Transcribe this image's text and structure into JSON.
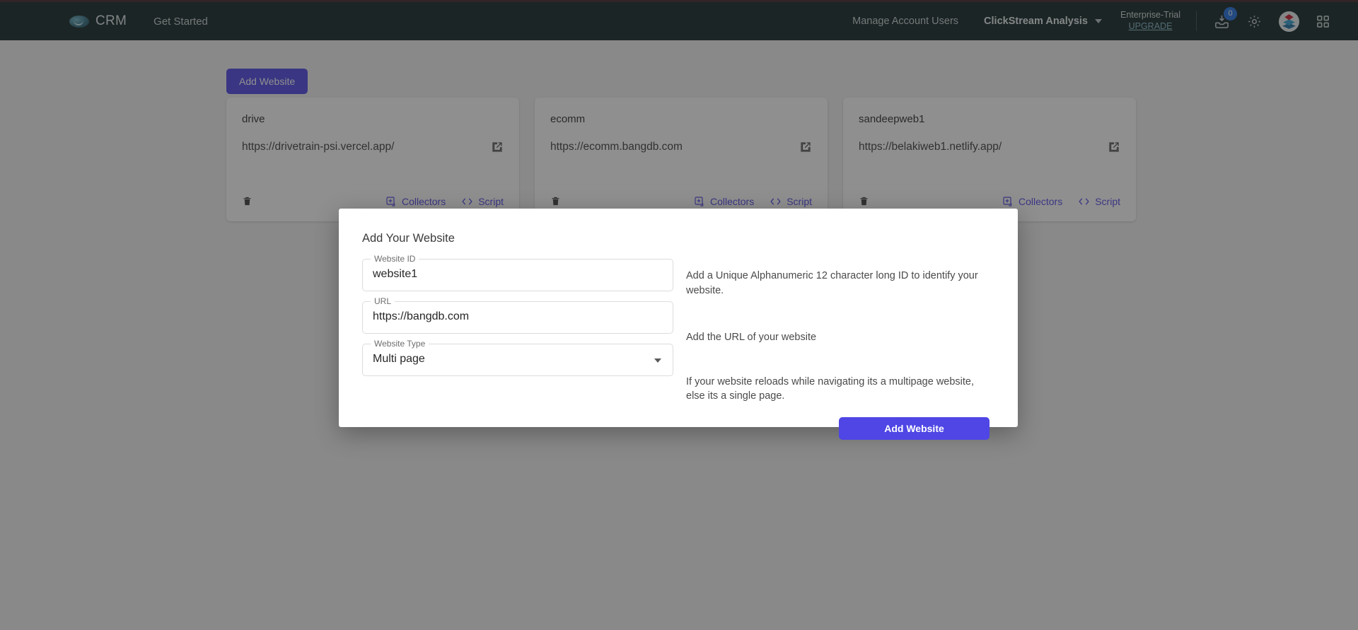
{
  "header": {
    "brand": "CRM",
    "get_started": "Get Started",
    "manage_account_users": "Manage Account Users",
    "clickstream_analysis": "ClickStream Analysis",
    "plan_name": "Enterprise-Trial",
    "upgrade": "UPGRADE",
    "inbox_badge": "0",
    "accent_color": "#4f46e5",
    "bar_color": "#102322"
  },
  "toolbar": {
    "add_website_label": "Add Website"
  },
  "cards": [
    {
      "name": "drive",
      "url": "https://drivetrain-psi.vercel.app/",
      "collectors_label": "Collectors",
      "script_label": "Script"
    },
    {
      "name": "ecomm",
      "url": "https://ecomm.bangdb.com",
      "collectors_label": "Collectors",
      "script_label": "Script"
    },
    {
      "name": "sandeepweb1",
      "url": "https://belakiweb1.netlify.app/",
      "collectors_label": "Collectors",
      "script_label": "Script"
    }
  ],
  "modal": {
    "title": "Add Your Website",
    "fields": [
      {
        "label": "Website ID",
        "value": "website1",
        "help": "Add a Unique Alphanumeric 12 character long ID to identify your website."
      },
      {
        "label": "URL",
        "value": "https://bangdb.com",
        "help": "Add the URL of your website"
      },
      {
        "label": "Website Type",
        "value": "Multi page",
        "help": "If your website reloads while navigating its a multipage website, else its a single page."
      }
    ],
    "submit_label": "Add Website"
  }
}
